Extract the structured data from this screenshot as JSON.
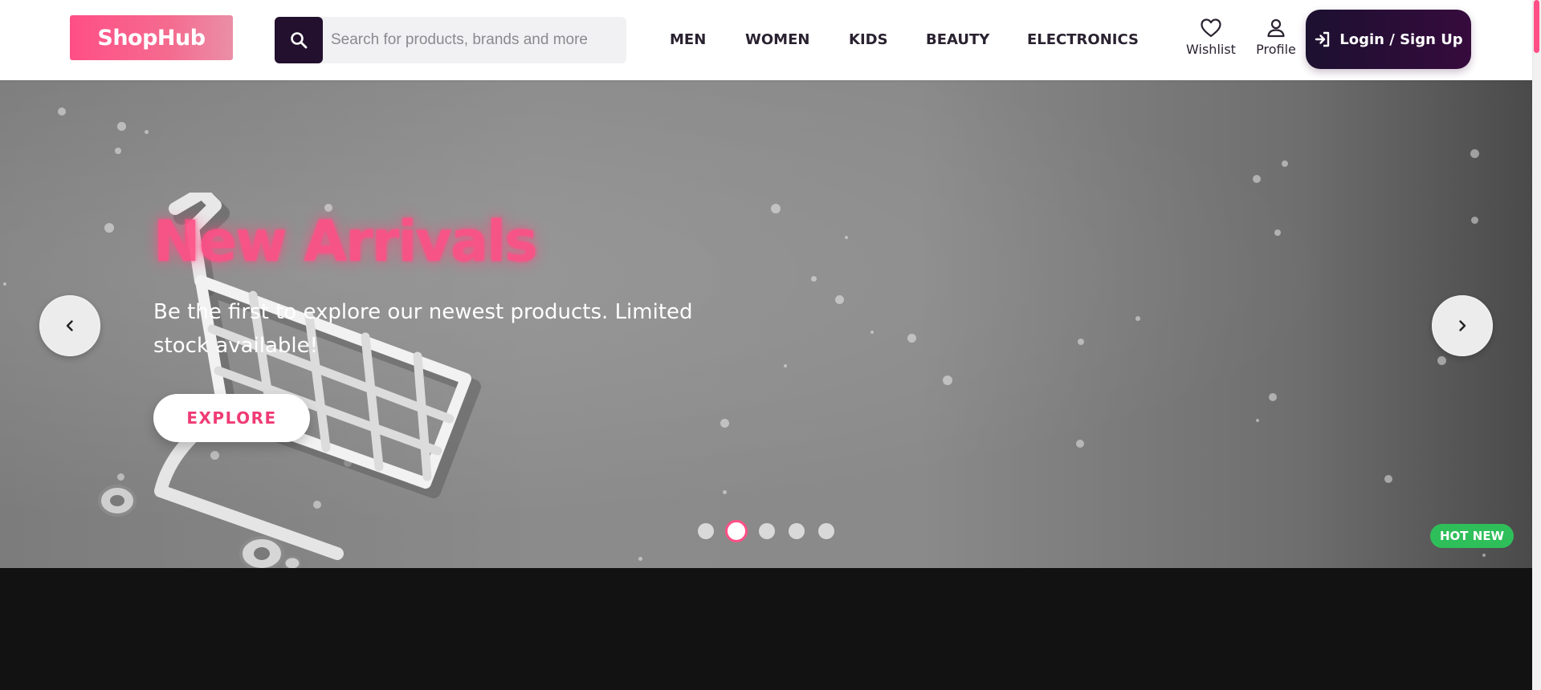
{
  "header": {
    "logo": "ShopHub",
    "search": {
      "placeholder": "Search for products, brands and more",
      "value": ""
    },
    "nav": [
      {
        "label": "MEN"
      },
      {
        "label": "WOMEN"
      },
      {
        "label": "KIDS"
      },
      {
        "label": "BEAUTY"
      },
      {
        "label": "ELECTRONICS"
      }
    ],
    "wishlist_label": "Wishlist",
    "profile_label": "Profile",
    "login_label": "Login / Sign Up"
  },
  "hero": {
    "title": "New Arrivals",
    "subtitle": "Be the first to explore our newest products. Limited stock available!",
    "cta_label": "EXPLORE",
    "badge": "HOT NEW",
    "slides_total": 5,
    "active_slide": 2
  },
  "icons": {
    "search": "search-icon",
    "wishlist": "heart-icon",
    "profile": "user-icon",
    "login": "login-icon",
    "prev": "chevron-left-icon",
    "next": "chevron-right-icon"
  },
  "colors": {
    "brand_pink": "#ff4f86",
    "dark_purple": "#22102e",
    "badge_green": "#2fbf5a",
    "hero_bg": "#8a8a8a",
    "page_bg": "#121212"
  }
}
